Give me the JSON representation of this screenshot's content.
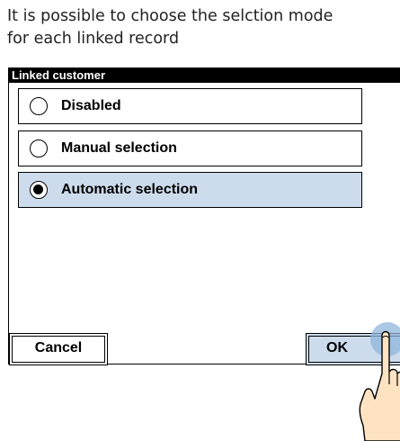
{
  "caption": {
    "line1": "It is possible to choose the selction mode",
    "line2": "for each linked record"
  },
  "dialog": {
    "title": "Linked customer",
    "options": [
      {
        "label": "Disabled",
        "selected": false
      },
      {
        "label": "Manual selection",
        "selected": false
      },
      {
        "label": "Automatic selection",
        "selected": true
      }
    ],
    "cancel_label": "Cancel",
    "ok_label": "OK"
  },
  "colors": {
    "selected_background": "#cddcec",
    "title_bar": "#000000",
    "hand_fill": "#fde3c2",
    "touch_highlight": "#8fb6dc"
  },
  "icons": {
    "pointer": "pointing-hand-icon"
  }
}
